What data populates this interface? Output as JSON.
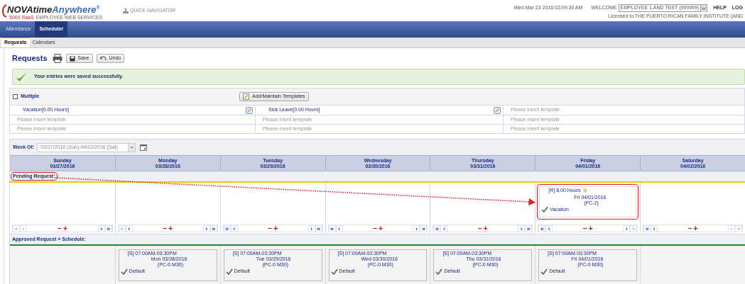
{
  "header": {
    "logo": {
      "brand_dark": "NOVAtime",
      "brand_blue": "Anywhere",
      "registered": "®",
      "edition": "5000 SaaS",
      "tagline": "EMPLOYEE WEB SERVICES"
    },
    "quick_navigator": "QUICK NAVIGATOR",
    "datetime": "Wed Mar 23 2016 02:09:30 AM",
    "welcome": "WELCOME",
    "employee": "EMPLOYEE 1,AND TEST (999999)",
    "links": [
      "HELP",
      "LOG"
    ],
    "license": "Licensed to:THE PUERTO RICAN FAMILY INSTITUTE (AND"
  },
  "nav_tabs": [
    {
      "label": "Attendance",
      "selected": false
    },
    {
      "label": "Scheduler",
      "selected": true
    }
  ],
  "sub_tabs": [
    {
      "label": "Requests",
      "selected": true
    },
    {
      "label": "Calendars",
      "selected": false
    }
  ],
  "page_title": "Requests",
  "toolbar": [
    "Save",
    "Undo"
  ],
  "message": "Your entries were saved successfully.",
  "templates": {
    "multiple": {
      "label": "Multiple",
      "checked": false
    },
    "add_button": "Add/Maintain Templates",
    "rows": [
      [
        {
          "text": "Vacation[0.00 Hours]",
          "kind": "template"
        },
        {
          "text": "Sick Leave[0.00 Hours]",
          "kind": "template"
        },
        {
          "text": "Please insert template",
          "kind": "empty"
        }
      ],
      [
        {
          "text": "Please insert template",
          "kind": "empty"
        },
        {
          "text": "Please insert template",
          "kind": "empty"
        },
        {
          "text": "Please insert template",
          "kind": "empty"
        }
      ],
      [
        {
          "text": "Please insert template",
          "kind": "empty"
        },
        {
          "text": "Please insert template",
          "kind": "empty"
        },
        {
          "text": "Please insert template",
          "kind": "empty"
        }
      ]
    ]
  },
  "week_of": {
    "label": "Week Of:",
    "value": "03/27/2016 (Sun)-04/02/2016 (Sat)"
  },
  "days": [
    {
      "name": "Sunday",
      "date": "03/27/2016",
      "pager": [
        {
          "kind": "nav",
          "text": "«",
          "disabled": true
        },
        {
          "kind": "nav",
          "text": "‹",
          "disabled": true
        },
        {
          "kind": "remove",
          "text": "−"
        },
        {
          "kind": "add",
          "text": "+"
        },
        {
          "kind": "nav",
          "text": "›",
          "disabled": false
        },
        {
          "kind": "nav",
          "text": "»",
          "disabled": false
        }
      ]
    },
    {
      "name": "Monday",
      "date": "03/28/2016",
      "pager": [
        {
          "kind": "nav",
          "text": "«",
          "disabled": true
        },
        {
          "kind": "nav",
          "text": "‹",
          "disabled": false
        },
        {
          "kind": "remove",
          "text": "−"
        },
        {
          "kind": "add",
          "text": "+"
        },
        {
          "kind": "nav",
          "text": "›",
          "disabled": false
        },
        {
          "kind": "nav",
          "text": "»",
          "disabled": false
        }
      ],
      "schedule": {
        "shift": "[S] 07:00AM-03:30PM",
        "date": "Mon 03/28/2016",
        "code": "(PC-0 M30)",
        "status": "Default"
      }
    },
    {
      "name": "Tuesday",
      "date": "03/29/2016",
      "pager": [
        {
          "kind": "nav",
          "text": "«",
          "disabled": false
        },
        {
          "kind": "nav",
          "text": "‹",
          "disabled": false
        },
        {
          "kind": "remove",
          "text": "−"
        },
        {
          "kind": "add",
          "text": "+"
        },
        {
          "kind": "nav",
          "text": "›",
          "disabled": false
        },
        {
          "kind": "nav",
          "text": "»",
          "disabled": false
        }
      ],
      "schedule": {
        "shift": "[S] 07:00AM-03:30PM",
        "date": "Tue 03/29/2016",
        "code": "(PC-0 M30)",
        "status": "Default"
      }
    },
    {
      "name": "Wednesday",
      "date": "03/30/2016",
      "pager": [
        {
          "kind": "nav",
          "text": "«",
          "disabled": false
        },
        {
          "kind": "nav",
          "text": "‹",
          "disabled": false
        },
        {
          "kind": "remove",
          "text": "−"
        },
        {
          "kind": "add",
          "text": "+"
        },
        {
          "kind": "nav",
          "text": "›",
          "disabled": false
        },
        {
          "kind": "nav",
          "text": "»",
          "disabled": false
        }
      ],
      "schedule": {
        "shift": "[S] 07:00AM-03:30PM",
        "date": "Wed 03/30/2016",
        "code": "(PC-0 M30)",
        "status": "Default"
      }
    },
    {
      "name": "Thursday",
      "date": "03/31/2016",
      "pager": [
        {
          "kind": "nav",
          "text": "«",
          "disabled": false
        },
        {
          "kind": "nav",
          "text": "‹",
          "disabled": false
        },
        {
          "kind": "remove",
          "text": "−"
        },
        {
          "kind": "add",
          "text": "+"
        },
        {
          "kind": "nav",
          "text": "›",
          "disabled": false
        },
        {
          "kind": "nav",
          "text": "»",
          "disabled": false
        }
      ],
      "schedule": {
        "shift": "[S] 07:00AM-03:30PM",
        "date": "Thu 03/31/2016",
        "code": "(PC-0 M30)",
        "status": "Default"
      }
    },
    {
      "name": "Friday",
      "date": "04/01/2016",
      "pager": [
        {
          "kind": "nav",
          "text": "«",
          "disabled": false
        },
        {
          "kind": "nav",
          "text": "‹",
          "disabled": false
        },
        {
          "kind": "remove",
          "text": "−"
        },
        {
          "kind": "add",
          "text": "+"
        },
        {
          "kind": "nav",
          "text": "›",
          "disabled": false
        },
        {
          "kind": "nav",
          "text": "»",
          "disabled": true
        }
      ],
      "request": {
        "hours": "[R] 8.00 Hours",
        "date": "Fri 04/01/2016",
        "code": "(PC-2)",
        "status": "Vacation",
        "highlighted": true
      },
      "schedule": {
        "shift": "[S] 07:00AM-03:30PM",
        "date": "Fri 04/01/2016",
        "code": "(PC-0 M30)",
        "status": "Default"
      }
    },
    {
      "name": "Saturday",
      "date": "04/02/2016",
      "pager": [
        {
          "kind": "nav",
          "text": "«",
          "disabled": false
        },
        {
          "kind": "nav",
          "text": "‹",
          "disabled": false
        },
        {
          "kind": "remove",
          "text": "−"
        },
        {
          "kind": "add",
          "text": "+"
        },
        {
          "kind": "nav",
          "text": "›",
          "disabled": true
        },
        {
          "kind": "nav",
          "text": "»",
          "disabled": true
        }
      ]
    }
  ],
  "pending_label": {
    "text": "Pending Request:",
    "highlighted": true
  },
  "approved_label": "Approved Request + Schedule:"
}
